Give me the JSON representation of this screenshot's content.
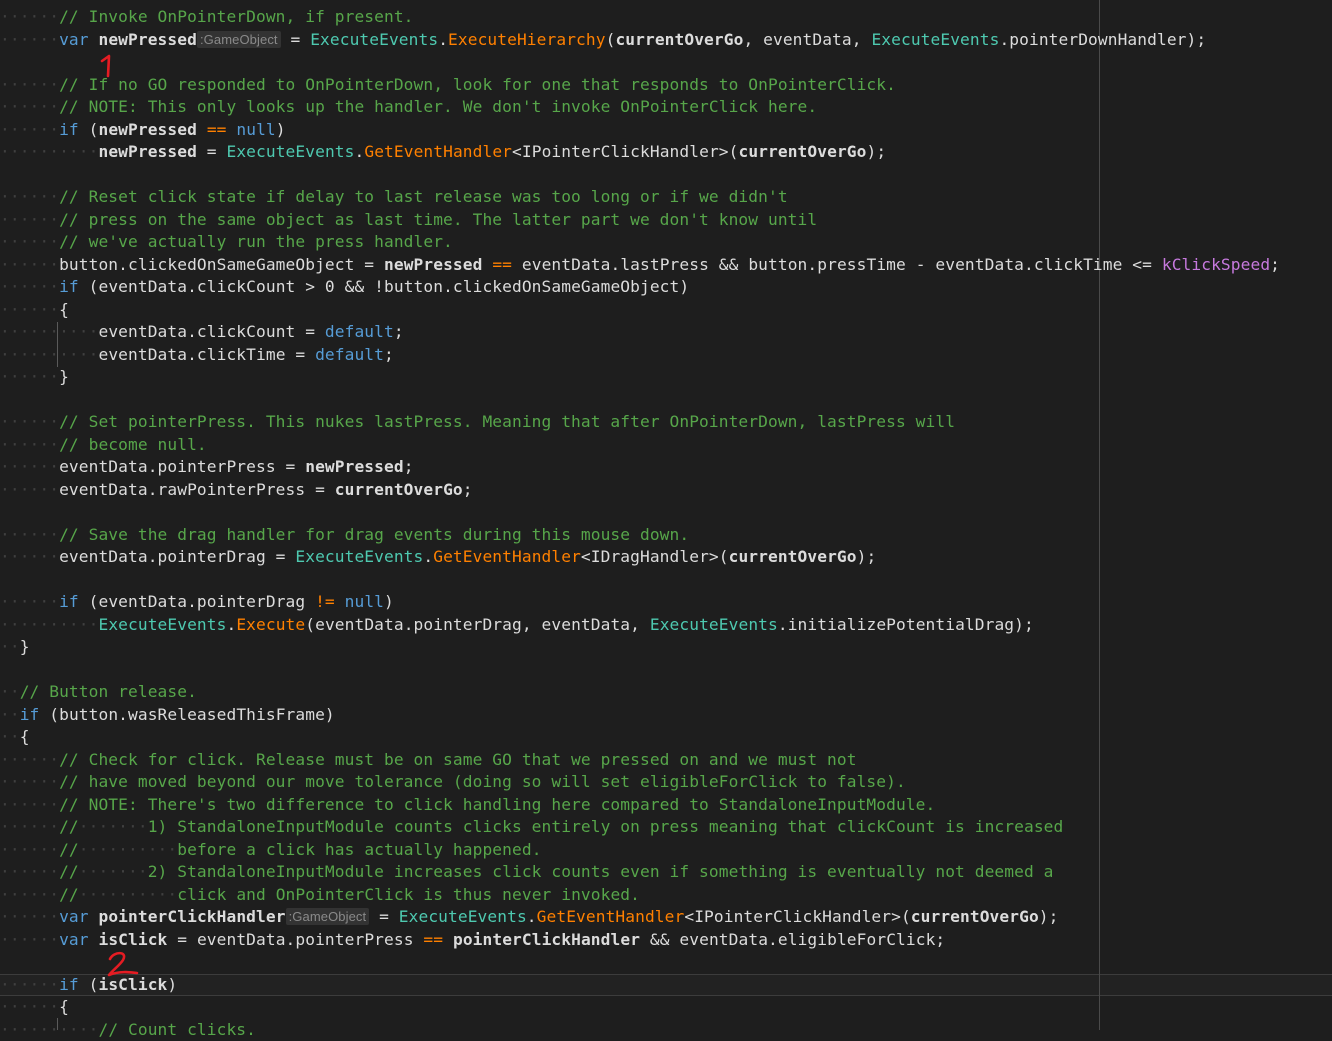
{
  "editor": {
    "lines": [
      [
        {
          "t": "ws",
          "v": "······"
        },
        {
          "t": "comment",
          "v": "// Invoke OnPointerDown, if present."
        }
      ],
      [
        {
          "t": "ws",
          "v": "······"
        },
        {
          "t": "kw",
          "v": "var"
        },
        {
          "t": "plain",
          "v": " "
        },
        {
          "t": "local",
          "v": "newPressed"
        },
        {
          "t": "hint",
          "v": ":GameObject"
        },
        {
          "t": "plain",
          "v": " = "
        },
        {
          "t": "type",
          "v": "ExecuteEvents"
        },
        {
          "t": "plain",
          "v": "."
        },
        {
          "t": "method",
          "v": "ExecuteHierarchy"
        },
        {
          "t": "plain",
          "v": "("
        },
        {
          "t": "local",
          "v": "currentOverGo"
        },
        {
          "t": "plain",
          "v": ", eventData, "
        },
        {
          "t": "type",
          "v": "ExecuteEvents"
        },
        {
          "t": "plain",
          "v": ".pointerDownHandler);"
        }
      ],
      [],
      [
        {
          "t": "ws",
          "v": "······"
        },
        {
          "t": "comment",
          "v": "// If no GO responded to OnPointerDown, look for one that responds to OnPointerClick."
        }
      ],
      [
        {
          "t": "ws",
          "v": "······"
        },
        {
          "t": "comment",
          "v": "// NOTE: This only looks up the handler. We don't invoke OnPointerClick here."
        }
      ],
      [
        {
          "t": "ws",
          "v": "······"
        },
        {
          "t": "kw",
          "v": "if"
        },
        {
          "t": "plain",
          "v": " ("
        },
        {
          "t": "local",
          "v": "newPressed"
        },
        {
          "t": "plain",
          "v": " "
        },
        {
          "t": "method",
          "v": "=="
        },
        {
          "t": "plain",
          "v": " "
        },
        {
          "t": "kw",
          "v": "null"
        },
        {
          "t": "plain",
          "v": ")"
        }
      ],
      [
        {
          "t": "ws",
          "v": "··········"
        },
        {
          "t": "local",
          "v": "newPressed"
        },
        {
          "t": "plain",
          "v": " = "
        },
        {
          "t": "type",
          "v": "ExecuteEvents"
        },
        {
          "t": "plain",
          "v": "."
        },
        {
          "t": "method",
          "v": "GetEventHandler"
        },
        {
          "t": "plain",
          "v": "<IPointerClickHandler>("
        },
        {
          "t": "local",
          "v": "currentOverGo"
        },
        {
          "t": "plain",
          "v": ");"
        }
      ],
      [],
      [
        {
          "t": "ws",
          "v": "······"
        },
        {
          "t": "comment",
          "v": "// Reset click state if delay to last release was too long or if we didn't"
        }
      ],
      [
        {
          "t": "ws",
          "v": "······"
        },
        {
          "t": "comment",
          "v": "// press on the same object as last time. The latter part we don't know until"
        }
      ],
      [
        {
          "t": "ws",
          "v": "······"
        },
        {
          "t": "comment",
          "v": "// we've actually run the press handler."
        }
      ],
      [
        {
          "t": "ws",
          "v": "······"
        },
        {
          "t": "plain",
          "v": "button.clickedOnSameGameObject = "
        },
        {
          "t": "local",
          "v": "newPressed"
        },
        {
          "t": "plain",
          "v": " "
        },
        {
          "t": "method",
          "v": "=="
        },
        {
          "t": "plain",
          "v": " eventData.lastPress && button.pressTime - eventData.clickTime <= "
        },
        {
          "t": "const",
          "v": "kClickSpeed"
        },
        {
          "t": "plain",
          "v": ";"
        }
      ],
      [
        {
          "t": "ws",
          "v": "······"
        },
        {
          "t": "kw",
          "v": "if"
        },
        {
          "t": "plain",
          "v": " (eventData.clickCount > 0 && !button.clickedOnSameGameObject)"
        }
      ],
      [
        {
          "t": "ws",
          "v": "······"
        },
        {
          "t": "plain",
          "v": "{"
        }
      ],
      [
        {
          "t": "ws",
          "v": "··········"
        },
        {
          "t": "plain",
          "v": "eventData.clickCount = "
        },
        {
          "t": "kw",
          "v": "default"
        },
        {
          "t": "plain",
          "v": ";"
        }
      ],
      [
        {
          "t": "ws",
          "v": "··········"
        },
        {
          "t": "plain",
          "v": "eventData.clickTime = "
        },
        {
          "t": "kw",
          "v": "default"
        },
        {
          "t": "plain",
          "v": ";"
        }
      ],
      [
        {
          "t": "ws",
          "v": "······"
        },
        {
          "t": "plain",
          "v": "}"
        }
      ],
      [],
      [
        {
          "t": "ws",
          "v": "······"
        },
        {
          "t": "comment",
          "v": "// Set pointerPress. This nukes lastPress. Meaning that after OnPointerDown, lastPress will"
        }
      ],
      [
        {
          "t": "ws",
          "v": "······"
        },
        {
          "t": "comment",
          "v": "// become null."
        }
      ],
      [
        {
          "t": "ws",
          "v": "······"
        },
        {
          "t": "plain",
          "v": "eventData.pointerPress = "
        },
        {
          "t": "local",
          "v": "newPressed"
        },
        {
          "t": "plain",
          "v": ";"
        }
      ],
      [
        {
          "t": "ws",
          "v": "······"
        },
        {
          "t": "plain",
          "v": "eventData.rawPointerPress = "
        },
        {
          "t": "local",
          "v": "currentOverGo"
        },
        {
          "t": "plain",
          "v": ";"
        }
      ],
      [],
      [
        {
          "t": "ws",
          "v": "······"
        },
        {
          "t": "comment",
          "v": "// Save the drag handler for drag events during this mouse down."
        }
      ],
      [
        {
          "t": "ws",
          "v": "······"
        },
        {
          "t": "plain",
          "v": "eventData.pointerDrag = "
        },
        {
          "t": "type",
          "v": "ExecuteEvents"
        },
        {
          "t": "plain",
          "v": "."
        },
        {
          "t": "method",
          "v": "GetEventHandler"
        },
        {
          "t": "plain",
          "v": "<IDragHandler>("
        },
        {
          "t": "local",
          "v": "currentOverGo"
        },
        {
          "t": "plain",
          "v": ");"
        }
      ],
      [],
      [
        {
          "t": "ws",
          "v": "······"
        },
        {
          "t": "kw",
          "v": "if"
        },
        {
          "t": "plain",
          "v": " (eventData.pointerDrag "
        },
        {
          "t": "method",
          "v": "!="
        },
        {
          "t": "plain",
          "v": " "
        },
        {
          "t": "kw",
          "v": "null"
        },
        {
          "t": "plain",
          "v": ")"
        }
      ],
      [
        {
          "t": "ws",
          "v": "··········"
        },
        {
          "t": "type",
          "v": "ExecuteEvents"
        },
        {
          "t": "plain",
          "v": "."
        },
        {
          "t": "method",
          "v": "Execute"
        },
        {
          "t": "plain",
          "v": "(eventData.pointerDrag, eventData, "
        },
        {
          "t": "type",
          "v": "ExecuteEvents"
        },
        {
          "t": "plain",
          "v": ".initializePotentialDrag);"
        }
      ],
      [
        {
          "t": "ws",
          "v": "··"
        },
        {
          "t": "plain",
          "v": "}"
        }
      ],
      [],
      [
        {
          "t": "ws",
          "v": "··"
        },
        {
          "t": "comment",
          "v": "// Button release."
        }
      ],
      [
        {
          "t": "ws",
          "v": "··"
        },
        {
          "t": "kw",
          "v": "if"
        },
        {
          "t": "plain",
          "v": " (button.wasReleasedThisFrame)"
        }
      ],
      [
        {
          "t": "ws",
          "v": "··"
        },
        {
          "t": "plain",
          "v": "{"
        }
      ],
      [
        {
          "t": "ws",
          "v": "······"
        },
        {
          "t": "comment",
          "v": "// Check for click. Release must be on same GO that we pressed on and we must not"
        }
      ],
      [
        {
          "t": "ws",
          "v": "······"
        },
        {
          "t": "comment",
          "v": "// have moved beyond our move tolerance (doing so will set eligibleForClick to false)."
        }
      ],
      [
        {
          "t": "ws",
          "v": "······"
        },
        {
          "t": "comment",
          "v": "// NOTE: There's two difference to click handling here compared to StandaloneInputModule."
        }
      ],
      [
        {
          "t": "ws",
          "v": "······"
        },
        {
          "t": "comment",
          "v": "//"
        },
        {
          "t": "ws",
          "v": "·······"
        },
        {
          "t": "comment",
          "v": "1) StandaloneInputModule counts clicks entirely on press meaning that clickCount is increased"
        }
      ],
      [
        {
          "t": "ws",
          "v": "······"
        },
        {
          "t": "comment",
          "v": "//"
        },
        {
          "t": "ws",
          "v": "··········"
        },
        {
          "t": "comment",
          "v": "before a click has actually happened."
        }
      ],
      [
        {
          "t": "ws",
          "v": "······"
        },
        {
          "t": "comment",
          "v": "//"
        },
        {
          "t": "ws",
          "v": "·······"
        },
        {
          "t": "comment",
          "v": "2) StandaloneInputModule increases click counts even if something is eventually not deemed a"
        }
      ],
      [
        {
          "t": "ws",
          "v": "······"
        },
        {
          "t": "comment",
          "v": "//"
        },
        {
          "t": "ws",
          "v": "··········"
        },
        {
          "t": "comment",
          "v": "click and OnPointerClick is thus never invoked."
        }
      ],
      [
        {
          "t": "ws",
          "v": "······"
        },
        {
          "t": "kw",
          "v": "var"
        },
        {
          "t": "plain",
          "v": " "
        },
        {
          "t": "local",
          "v": "pointerClickHandler"
        },
        {
          "t": "hint",
          "v": ":GameObject"
        },
        {
          "t": "plain",
          "v": " = "
        },
        {
          "t": "type",
          "v": "ExecuteEvents"
        },
        {
          "t": "plain",
          "v": "."
        },
        {
          "t": "method",
          "v": "GetEventHandler"
        },
        {
          "t": "plain",
          "v": "<IPointerClickHandler>("
        },
        {
          "t": "local",
          "v": "currentOverGo"
        },
        {
          "t": "plain",
          "v": ");"
        }
      ],
      [
        {
          "t": "ws",
          "v": "······"
        },
        {
          "t": "kw",
          "v": "var"
        },
        {
          "t": "plain",
          "v": " "
        },
        {
          "t": "local",
          "v": "isClick"
        },
        {
          "t": "plain",
          "v": " = eventData.pointerPress "
        },
        {
          "t": "method",
          "v": "=="
        },
        {
          "t": "plain",
          "v": " "
        },
        {
          "t": "local",
          "v": "pointerClickHandler"
        },
        {
          "t": "plain",
          "v": " && eventData.eligibleForClick;"
        }
      ],
      [],
      [
        {
          "t": "ws",
          "v": "······"
        },
        {
          "t": "kw",
          "v": "if"
        },
        {
          "t": "plain",
          "v": " ("
        },
        {
          "t": "local",
          "v": "isClick"
        },
        {
          "t": "plain",
          "v": ")"
        }
      ],
      [
        {
          "t": "ws",
          "v": "······"
        },
        {
          "t": "plain",
          "v": "{"
        }
      ],
      [
        {
          "t": "ws",
          "v": "··········"
        },
        {
          "t": "comment",
          "v": "// Count clicks."
        }
      ]
    ],
    "annotations": [
      {
        "label": "1",
        "color": "#e51c23"
      },
      {
        "label": "2",
        "color": "#e51c23"
      }
    ],
    "colors": {
      "background": "#1e1e1e",
      "comment": "#57a64a",
      "keyword": "#569cd6",
      "type": "#4ec9b0",
      "method": "#ff8000",
      "constant": "#c679dd",
      "text": "#dcdcdc",
      "whitespace": "#404040"
    }
  }
}
